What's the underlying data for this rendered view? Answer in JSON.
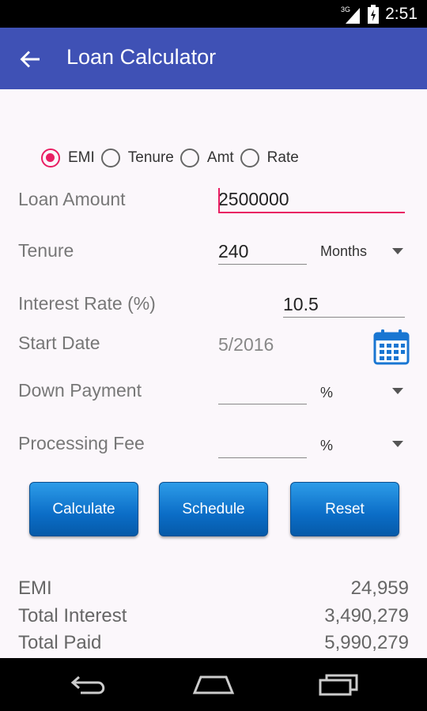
{
  "status_bar": {
    "network": "3G",
    "time": "2:51"
  },
  "app_bar": {
    "title": "Loan Calculator",
    "back_icon": "arrow-left-icon"
  },
  "mode_selector": {
    "options": [
      {
        "label": "EMI",
        "selected": true
      },
      {
        "label": "Tenure",
        "selected": false
      },
      {
        "label": "Amt",
        "selected": false
      },
      {
        "label": "Rate",
        "selected": false
      }
    ],
    "accent_color": "#e91e63"
  },
  "form": {
    "loan_amount": {
      "label": "Loan Amount",
      "value": "2500000"
    },
    "tenure": {
      "label": "Tenure",
      "value": "240",
      "unit": "Months"
    },
    "interest_rate": {
      "label": "Interest Rate (%)",
      "value": "10.5"
    },
    "start_date": {
      "label": "Start Date",
      "value": "5/2016",
      "icon": "calendar-icon"
    },
    "down_payment": {
      "label": "Down Payment",
      "value": "",
      "unit": "%"
    },
    "processing_fee": {
      "label": "Processing Fee",
      "value": "",
      "unit": "%"
    }
  },
  "buttons": {
    "calculate": "Calculate",
    "schedule": "Schedule",
    "reset": "Reset"
  },
  "results": {
    "emi": {
      "label": "EMI",
      "value": "24,959"
    },
    "total_interest": {
      "label": "Total Interest",
      "value": "3,490,279"
    },
    "total_paid": {
      "label": "Total Paid",
      "value": "5,990,279"
    }
  },
  "nav_bar": {
    "back": "back-icon",
    "home": "home-icon",
    "recents": "recents-icon"
  },
  "colors": {
    "app_bar": "#3f51b5",
    "button": "#0b6dc7",
    "background": "#fbf7fb"
  }
}
